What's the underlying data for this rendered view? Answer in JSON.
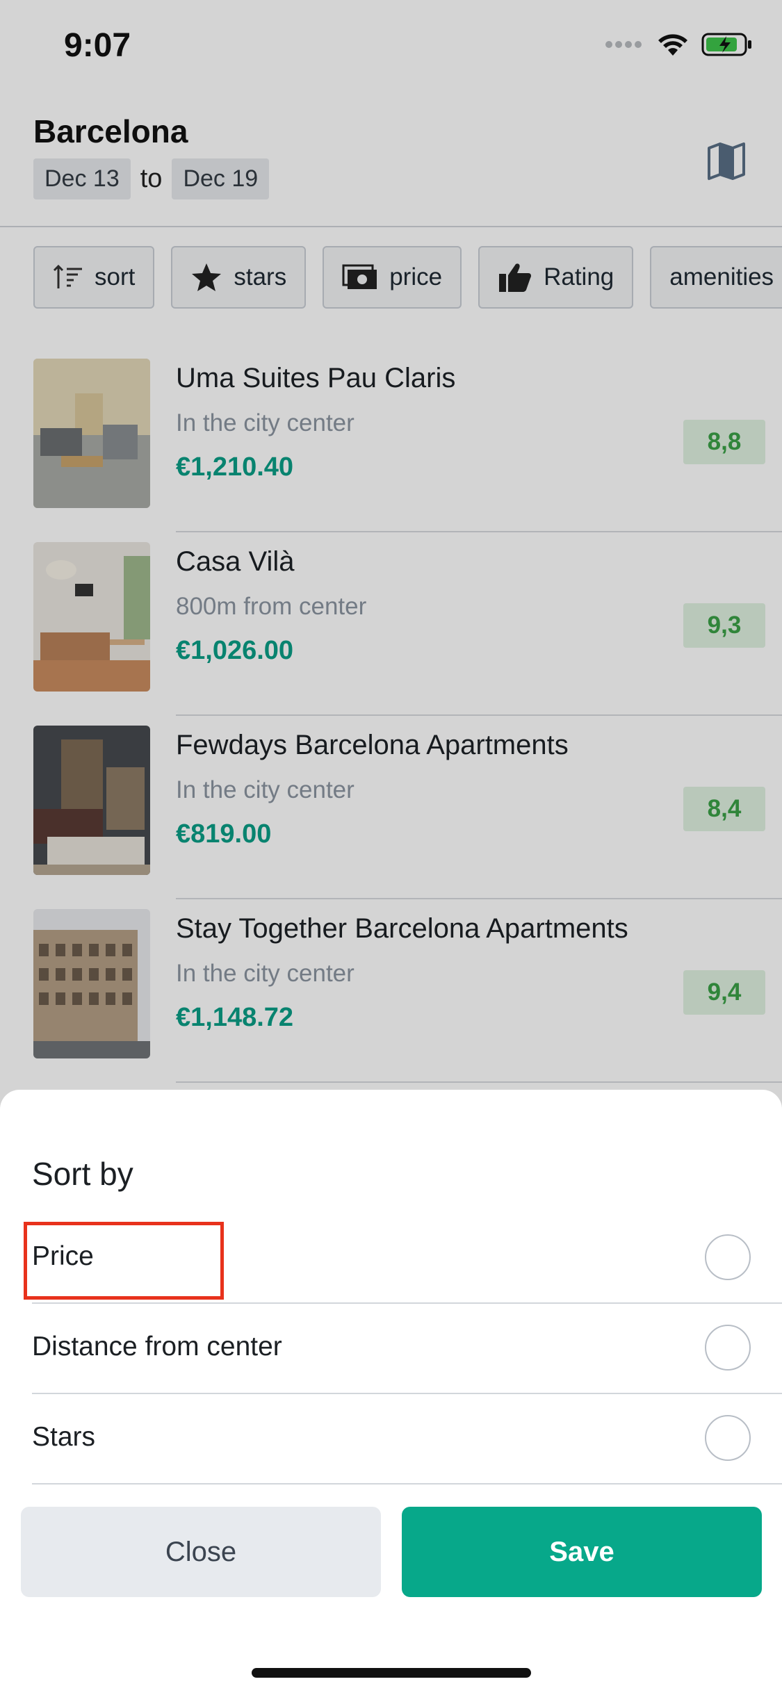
{
  "status_bar": {
    "time": "9:07"
  },
  "header": {
    "city": "Barcelona",
    "date_from": "Dec 13",
    "date_connector": "to",
    "date_to": "Dec 19",
    "map_icon": "map-icon"
  },
  "filters": [
    {
      "label": "sort",
      "icon": "sort-icon"
    },
    {
      "label": "stars",
      "icon": "star-icon"
    },
    {
      "label": "price",
      "icon": "cash-icon"
    },
    {
      "label": "Rating",
      "icon": "thumbs-up-icon"
    },
    {
      "label": "amenities",
      "icon": ""
    }
  ],
  "hotels": [
    {
      "name": "Uma Suites Pau Claris",
      "location": "In the city center",
      "price": "€1,210.40",
      "rating": "8,8"
    },
    {
      "name": "Casa Vilà",
      "location": "800m from center",
      "price": "€1,026.00",
      "rating": "9,3"
    },
    {
      "name": "Fewdays Barcelona Apartments",
      "location": "In the city center",
      "price": "€819.00",
      "rating": "8,4"
    },
    {
      "name": "Stay Together Barcelona Apartments",
      "location": "In the city center",
      "price": "€1,148.72",
      "rating": "9,4"
    }
  ],
  "sort_sheet": {
    "title": "Sort by",
    "options": [
      "Price",
      "Distance from center",
      "Stars"
    ],
    "close_label": "Close",
    "save_label": "Save"
  },
  "colors": {
    "accent": "#07a88a",
    "price": "#0a9e86",
    "rating_text": "#3aa046",
    "rating_bg": "#dff1e0",
    "highlight": "#e8321c"
  }
}
